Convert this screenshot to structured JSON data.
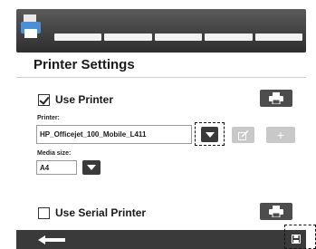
{
  "header": {
    "icon": "printer-app-icon",
    "tabs": [
      "",
      "",
      "",
      "",
      ""
    ]
  },
  "page": {
    "title": "Printer Settings"
  },
  "printer_section": {
    "use_printer_label": "Use Printer",
    "use_printer_checked": true,
    "printer_label": "Printer:",
    "printer_value": "HP_Officejet_100_Mobile_L411",
    "media_size_label": "Media size:",
    "media_size_value": "A4",
    "add_glyph": "+"
  },
  "serial_section": {
    "use_serial_label": "Use Serial Printer",
    "use_serial_checked": false
  },
  "footer": {
    "back_icon": "back-arrow-icon",
    "save_icon": "save-icon"
  }
}
